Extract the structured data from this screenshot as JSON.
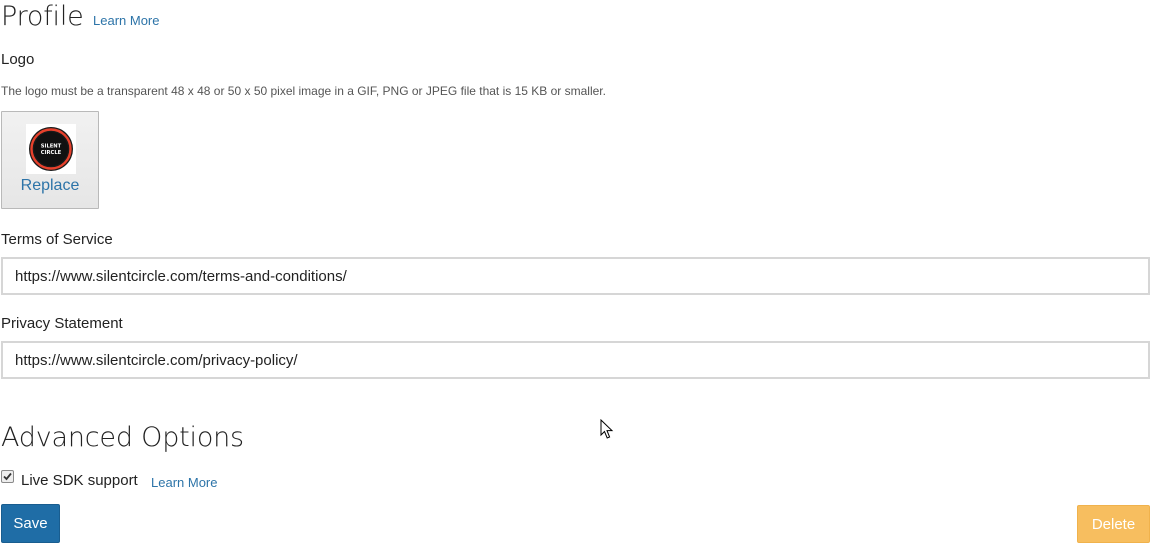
{
  "profile": {
    "heading": "Profile",
    "learn_more": "Learn More"
  },
  "logo": {
    "label": "Logo",
    "hint": "The logo must be a transparent 48 x 48 or 50 x 50 pixel image in a GIF, PNG or JPEG file that is 15 KB or smaller.",
    "image_text_line1": "SILENT",
    "image_text_line2": "CIRCLE",
    "replace_label": "Replace"
  },
  "terms": {
    "label": "Terms of Service",
    "value": "https://www.silentcircle.com/terms-and-conditions/"
  },
  "privacy": {
    "label": "Privacy Statement",
    "value": "https://www.silentcircle.com/privacy-policy/"
  },
  "advanced": {
    "heading": "Advanced Options",
    "live_sdk_label": "Live SDK support",
    "live_sdk_checked": true,
    "learn_more": "Learn More"
  },
  "actions": {
    "save_label": "Save",
    "delete_label": "Delete"
  },
  "colors": {
    "link": "#2d74a8",
    "save_button": "#1f6da6",
    "delete_button": "#f7be5f"
  }
}
